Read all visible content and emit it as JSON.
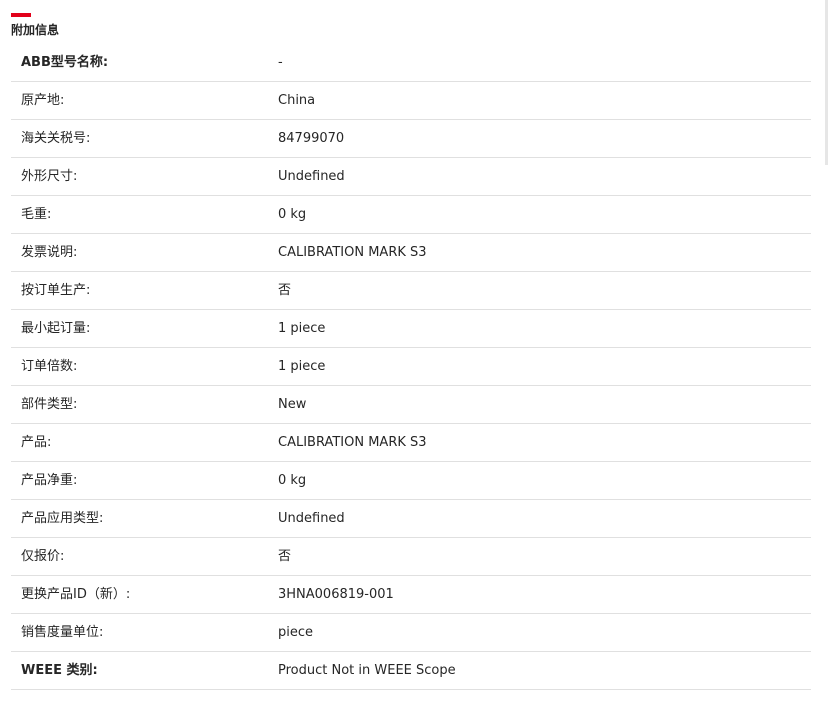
{
  "section": {
    "title": "附加信息",
    "accent_color": "#e2001a"
  },
  "rows": [
    {
      "label": "ABB型号名称:",
      "value": "-"
    },
    {
      "label": "原产地:",
      "value": "China"
    },
    {
      "label": "海关关税号:",
      "value": "84799070"
    },
    {
      "label": "外形尺寸:",
      "value": "Undefined"
    },
    {
      "label": "毛重:",
      "value": "0 kg"
    },
    {
      "label": "发票说明:",
      "value": "CALIBRATION MARK S3"
    },
    {
      "label": "按订单生产:",
      "value": "否"
    },
    {
      "label": "最小起订量:",
      "value": "1 piece"
    },
    {
      "label": "订单倍数:",
      "value": "1 piece"
    },
    {
      "label": "部件类型:",
      "value": "New"
    },
    {
      "label": "产品:",
      "value": "CALIBRATION MARK S3"
    },
    {
      "label": "产品净重:",
      "value": "0 kg"
    },
    {
      "label": "产品应用类型:",
      "value": "Undefined"
    },
    {
      "label": "仅报价:",
      "value": "否"
    },
    {
      "label": "更换产品ID（新）:",
      "value": "3HNA006819-001"
    },
    {
      "label": "销售度量单位:",
      "value": "piece"
    },
    {
      "label": "WEEE 类别:",
      "value": "Product Not in WEEE Scope"
    }
  ]
}
